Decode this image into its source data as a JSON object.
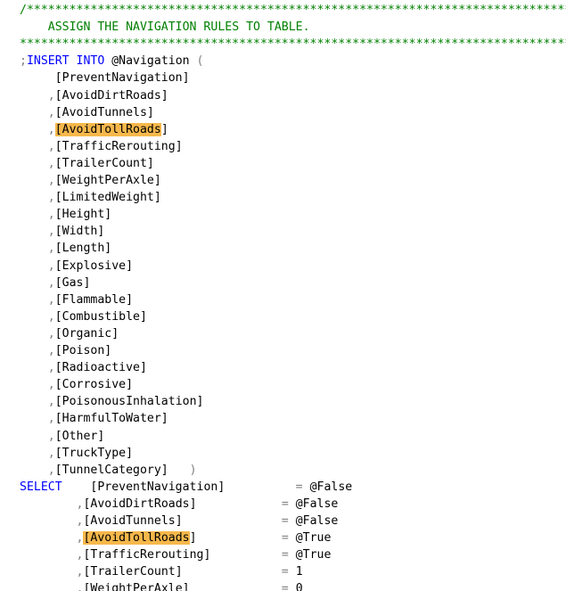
{
  "editor": {
    "colors": {
      "background": "#ffffff",
      "comment": "#008000",
      "keyword": "#0000ff",
      "punctuation": "#808080",
      "text": "#000000",
      "highlight": "#f6b84b"
    },
    "lines": [
      {
        "indent": "",
        "tokens": [
          {
            "t": "/*******************************************************************************",
            "k": "comment"
          }
        ]
      },
      {
        "indent": "    ",
        "tokens": [
          {
            "t": "ASSIGN THE NAVIGATION RULES TO TABLE.",
            "k": "comment"
          }
        ]
      },
      {
        "indent": "",
        "tokens": [
          {
            "t": "*******************************************************************************",
            "k": "comment"
          }
        ]
      },
      {
        "indent": "",
        "tokens": [
          {
            "t": ";",
            "k": "punct"
          },
          {
            "t": "INSERT INTO",
            "k": "keyword"
          },
          {
            "t": " @Navigation ",
            "k": "var"
          },
          {
            "t": "(",
            "k": "punct"
          }
        ]
      },
      {
        "indent": "     ",
        "tokens": [
          {
            "t": "[PreventNavigation]",
            "k": "ident"
          }
        ]
      },
      {
        "indent": "    ",
        "tokens": [
          {
            "t": ",",
            "k": "punct"
          },
          {
            "t": "[AvoidDirtRoads]",
            "k": "ident"
          }
        ]
      },
      {
        "indent": "    ",
        "tokens": [
          {
            "t": ",",
            "k": "punct"
          },
          {
            "t": "[AvoidTunnels]",
            "k": "ident"
          }
        ]
      },
      {
        "indent": "    ",
        "tokens": [
          {
            "t": ",",
            "k": "punct"
          },
          {
            "t": "[AvoidTollRoads",
            "k": "ident",
            "hl": true
          },
          {
            "t": "]",
            "k": "ident"
          }
        ]
      },
      {
        "indent": "    ",
        "tokens": [
          {
            "t": ",",
            "k": "punct"
          },
          {
            "t": "[TrafficRerouting]",
            "k": "ident"
          }
        ]
      },
      {
        "indent": "    ",
        "tokens": [
          {
            "t": ",",
            "k": "punct"
          },
          {
            "t": "[TrailerCount]",
            "k": "ident"
          }
        ]
      },
      {
        "indent": "    ",
        "tokens": [
          {
            "t": ",",
            "k": "punct"
          },
          {
            "t": "[WeightPerAxle]",
            "k": "ident"
          }
        ]
      },
      {
        "indent": "    ",
        "tokens": [
          {
            "t": ",",
            "k": "punct"
          },
          {
            "t": "[LimitedWeight]",
            "k": "ident"
          }
        ]
      },
      {
        "indent": "    ",
        "tokens": [
          {
            "t": ",",
            "k": "punct"
          },
          {
            "t": "[Height]",
            "k": "ident"
          }
        ]
      },
      {
        "indent": "    ",
        "tokens": [
          {
            "t": ",",
            "k": "punct"
          },
          {
            "t": "[Width]",
            "k": "ident"
          }
        ]
      },
      {
        "indent": "    ",
        "tokens": [
          {
            "t": ",",
            "k": "punct"
          },
          {
            "t": "[Length]",
            "k": "ident"
          }
        ]
      },
      {
        "indent": "    ",
        "tokens": [
          {
            "t": ",",
            "k": "punct"
          },
          {
            "t": "[Explosive]",
            "k": "ident"
          }
        ]
      },
      {
        "indent": "    ",
        "tokens": [
          {
            "t": ",",
            "k": "punct"
          },
          {
            "t": "[Gas]",
            "k": "ident"
          }
        ]
      },
      {
        "indent": "    ",
        "tokens": [
          {
            "t": ",",
            "k": "punct"
          },
          {
            "t": "[Flammable]",
            "k": "ident"
          }
        ]
      },
      {
        "indent": "    ",
        "tokens": [
          {
            "t": ",",
            "k": "punct"
          },
          {
            "t": "[Combustible]",
            "k": "ident"
          }
        ]
      },
      {
        "indent": "    ",
        "tokens": [
          {
            "t": ",",
            "k": "punct"
          },
          {
            "t": "[Organic]",
            "k": "ident"
          }
        ]
      },
      {
        "indent": "    ",
        "tokens": [
          {
            "t": ",",
            "k": "punct"
          },
          {
            "t": "[Poison]",
            "k": "ident"
          }
        ]
      },
      {
        "indent": "    ",
        "tokens": [
          {
            "t": ",",
            "k": "punct"
          },
          {
            "t": "[Radioactive]",
            "k": "ident"
          }
        ]
      },
      {
        "indent": "    ",
        "tokens": [
          {
            "t": ",",
            "k": "punct"
          },
          {
            "t": "[Corrosive]",
            "k": "ident"
          }
        ]
      },
      {
        "indent": "    ",
        "tokens": [
          {
            "t": ",",
            "k": "punct"
          },
          {
            "t": "[PoisonousInhalation]",
            "k": "ident"
          }
        ]
      },
      {
        "indent": "    ",
        "tokens": [
          {
            "t": ",",
            "k": "punct"
          },
          {
            "t": "[HarmfulToWater]",
            "k": "ident"
          }
        ]
      },
      {
        "indent": "    ",
        "tokens": [
          {
            "t": ",",
            "k": "punct"
          },
          {
            "t": "[Other]",
            "k": "ident"
          }
        ]
      },
      {
        "indent": "    ",
        "tokens": [
          {
            "t": ",",
            "k": "punct"
          },
          {
            "t": "[TruckType]",
            "k": "ident"
          }
        ]
      },
      {
        "indent": "    ",
        "tokens": [
          {
            "t": ",",
            "k": "punct"
          },
          {
            "t": "[TunnelCategory]",
            "k": "ident"
          },
          {
            "t": "   ",
            "k": "ident"
          },
          {
            "t": ")",
            "k": "punct"
          }
        ]
      },
      {
        "indent": "",
        "tokens": [
          {
            "t": "SELECT",
            "k": "keyword"
          },
          {
            "t": "    ",
            "k": "ident"
          },
          {
            "t": "[PreventNavigation]",
            "k": "ident"
          },
          {
            "t": "          ",
            "k": "ident"
          },
          {
            "t": "=",
            "k": "punct"
          },
          {
            "t": " @False",
            "k": "var"
          }
        ]
      },
      {
        "indent": "        ",
        "tokens": [
          {
            "t": ",",
            "k": "punct"
          },
          {
            "t": "[AvoidDirtRoads]",
            "k": "ident"
          },
          {
            "t": "            ",
            "k": "ident"
          },
          {
            "t": "=",
            "k": "punct"
          },
          {
            "t": " @False",
            "k": "var"
          }
        ]
      },
      {
        "indent": "        ",
        "tokens": [
          {
            "t": ",",
            "k": "punct"
          },
          {
            "t": "[AvoidTunnels]",
            "k": "ident"
          },
          {
            "t": "              ",
            "k": "ident"
          },
          {
            "t": "=",
            "k": "punct"
          },
          {
            "t": " @False",
            "k": "var"
          }
        ]
      },
      {
        "indent": "        ",
        "tokens": [
          {
            "t": ",",
            "k": "punct"
          },
          {
            "t": "[AvoidTollRoads",
            "k": "ident",
            "hl": true
          },
          {
            "t": "]",
            "k": "ident"
          },
          {
            "t": "            ",
            "k": "ident"
          },
          {
            "t": "=",
            "k": "punct"
          },
          {
            "t": " @True",
            "k": "var"
          }
        ]
      },
      {
        "indent": "        ",
        "tokens": [
          {
            "t": ",",
            "k": "punct"
          },
          {
            "t": "[TrafficRerouting]",
            "k": "ident"
          },
          {
            "t": "          ",
            "k": "ident"
          },
          {
            "t": "=",
            "k": "punct"
          },
          {
            "t": " @True",
            "k": "var"
          }
        ]
      },
      {
        "indent": "        ",
        "tokens": [
          {
            "t": ",",
            "k": "punct"
          },
          {
            "t": "[TrailerCount]",
            "k": "ident"
          },
          {
            "t": "              ",
            "k": "ident"
          },
          {
            "t": "=",
            "k": "punct"
          },
          {
            "t": " 1",
            "k": "num"
          }
        ]
      },
      {
        "indent": "        ",
        "tokens": [
          {
            "t": ",",
            "k": "punct"
          },
          {
            "t": "[WeightPerAxle]",
            "k": "ident"
          },
          {
            "t": "             ",
            "k": "ident"
          },
          {
            "t": "=",
            "k": "punct"
          },
          {
            "t": " 0",
            "k": "num"
          }
        ]
      }
    ]
  }
}
